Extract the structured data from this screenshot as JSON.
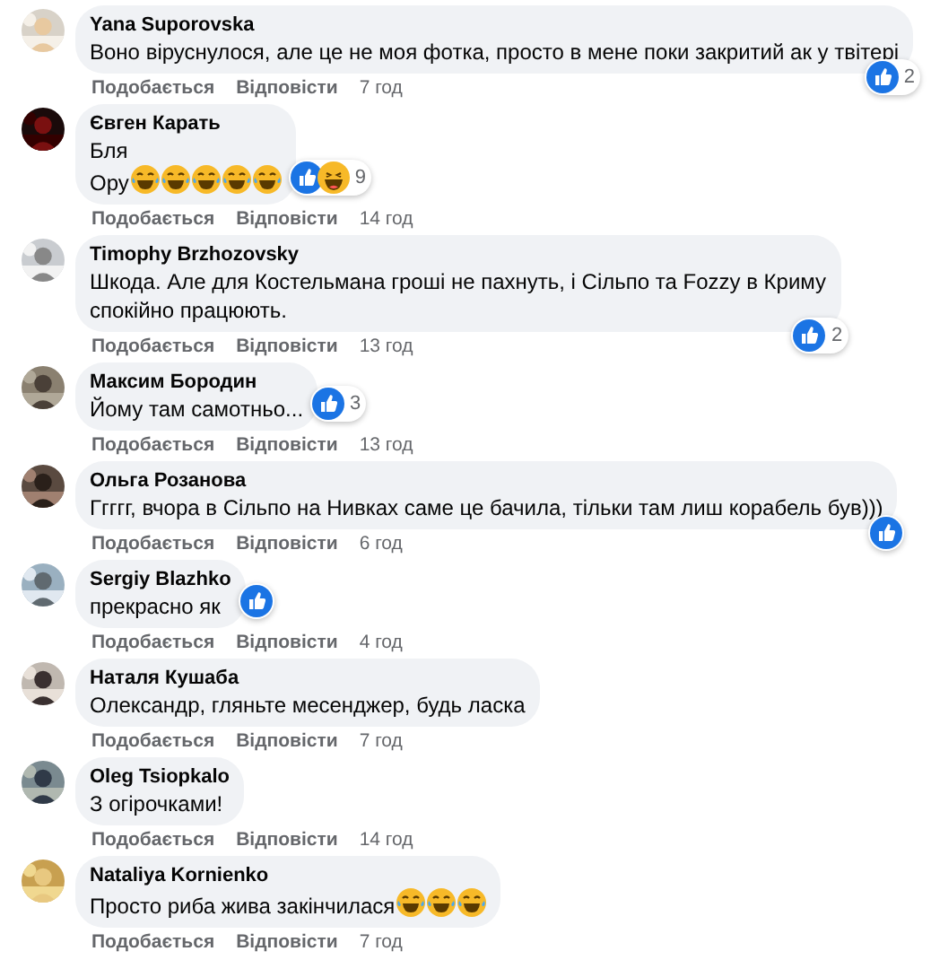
{
  "comments": [
    {
      "author": "Yana Suporovska",
      "lines": [
        "Воно віруснулося, але це не моя фотка, просто в мене поки закритий ак у твітері"
      ],
      "reactions": [
        {
          "kind": "like"
        }
      ],
      "reaction_count": "2",
      "actions": [
        "Подобається",
        "Відповісти"
      ],
      "time": "7 год"
    },
    {
      "author": "Євген Карать",
      "lines": [
        "Бля",
        "Ору"
      ],
      "emojis": [
        {
          "kind": "laugh"
        },
        {
          "kind": "laugh"
        },
        {
          "kind": "laugh"
        },
        {
          "kind": "laugh"
        },
        {
          "kind": "laugh"
        }
      ],
      "reactions": [
        {
          "kind": "like"
        },
        {
          "kind": "haha"
        }
      ],
      "reaction_count": "9",
      "actions": [
        "Подобається",
        "Відповісти"
      ],
      "time": "14 год"
    },
    {
      "author": "Timophy Brzhozovsky",
      "lines": [
        "Шкода. Але для Костельмана гроші не пахнуть, і Сільпо та Fozzy в Криму",
        "спокійно працюють."
      ],
      "reactions": [
        {
          "kind": "like"
        }
      ],
      "reaction_count": "2",
      "actions": [
        "Подобається",
        "Відповісти"
      ],
      "time": "13 год"
    },
    {
      "author": "Максим Бородин",
      "lines": [
        "Йому там самотньо..."
      ],
      "reactions": [
        {
          "kind": "like"
        }
      ],
      "reaction_count": "3",
      "actions": [
        "Подобається",
        "Відповісти"
      ],
      "time": "13 год"
    },
    {
      "author": "Ольга Розанова",
      "lines": [
        "Ггггг, вчора в Сільпо на Нивках саме це бачила, тільки там лиш корабель був)))"
      ],
      "reactions": [
        {
          "kind": "like"
        }
      ],
      "actions": [
        "Подобається",
        "Відповісти"
      ],
      "time": "6 год"
    },
    {
      "author": "Sergiy Blazhko",
      "lines": [
        "прекрасно як"
      ],
      "reactions": [
        {
          "kind": "like"
        }
      ],
      "actions": [
        "Подобається",
        "Відповісти"
      ],
      "time": "4 год"
    },
    {
      "author": "Наталя Кушаба",
      "lines": [
        "Олександр, гляньте месенджер, будь ласка"
      ],
      "actions": [
        "Подобається",
        "Відповісти"
      ],
      "time": "7 год"
    },
    {
      "author": "Oleg Tsiopkalo",
      "lines": [
        "З огірочками!"
      ],
      "actions": [
        "Подобається",
        "Відповісти"
      ],
      "time": "14 год"
    },
    {
      "author": "Nataliya Kornienko",
      "lines": [
        "Просто риба жива закінчилася"
      ],
      "emojis": [
        {
          "kind": "laugh"
        },
        {
          "kind": "laugh"
        },
        {
          "kind": "laugh"
        }
      ],
      "actions": [
        "Подобається",
        "Відповісти"
      ],
      "time": "7 год"
    }
  ]
}
